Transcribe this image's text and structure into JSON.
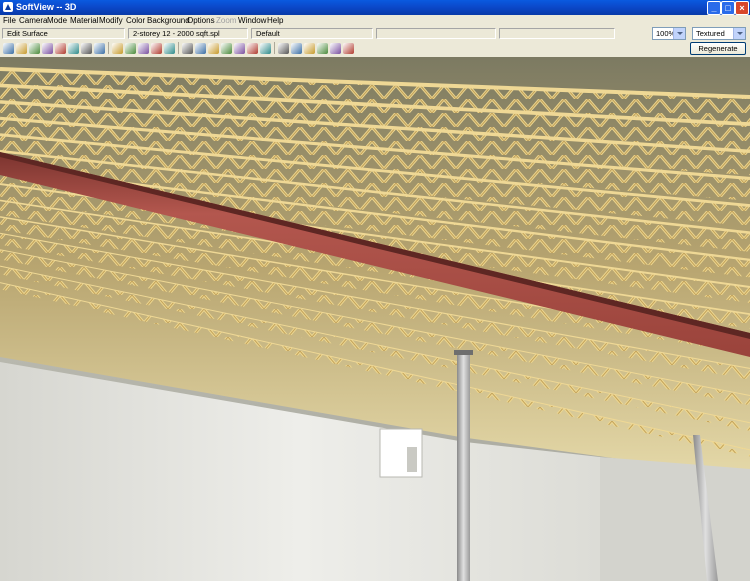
{
  "window": {
    "title": "SoftView -- 3D"
  },
  "menu": [
    "File",
    "Camera",
    "Mode",
    "Material",
    "Modify",
    "Color",
    "Background",
    "Options",
    "Zoom",
    "Window",
    "Help"
  ],
  "menu_disabled": [
    "Zoom"
  ],
  "status": {
    "mode": "Edit Surface",
    "file": "2-storey 12 - 2000 sqft.spl",
    "scheme": "Default"
  },
  "zoom": {
    "value": "100%"
  },
  "render_mode": {
    "value": "Textured"
  },
  "buttons": {
    "regenerate": "Regenerate"
  },
  "toolbar_icons": [
    "edit-icon",
    "open-icon",
    "save-icon",
    "print-icon",
    "copy-icon",
    "view1-icon",
    "view2-icon",
    "view3-icon",
    "camera-icon",
    "move-icon",
    "pencil-icon",
    "undo-icon",
    "redo-icon",
    "image-icon",
    "select-icon",
    "grid-icon",
    "zoom-in-icon",
    "zoom-out-icon",
    "zoom-fit-icon",
    "sun-icon",
    "walk-icon",
    "fly-icon",
    "orbit-icon",
    "light-icon",
    "pan-icon",
    "fullscreen-icon"
  ],
  "colors": {
    "accent": "#0a5ae0",
    "beam": "#a94b44",
    "joist": "#e8d08a",
    "wall": "#e5e6e2"
  }
}
